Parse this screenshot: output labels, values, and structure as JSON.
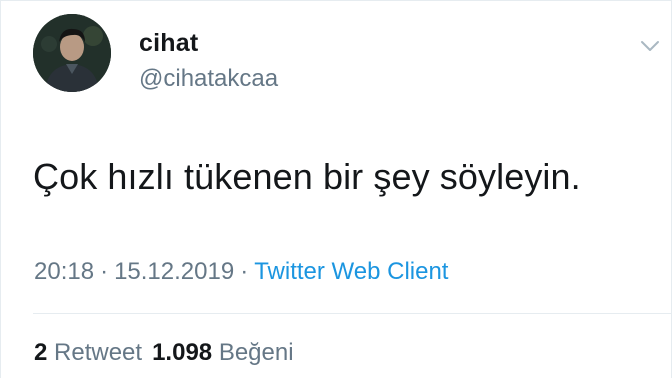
{
  "tweet": {
    "author": {
      "display_name": "cihat",
      "handle": "@cihatakcaa",
      "avatar_icon": "profile-photo"
    },
    "menu_icon": "chevron-down-icon",
    "text": "Çok hızlı tükenen bir şey söyleyin.",
    "meta": {
      "time": "20:18",
      "separator": "·",
      "date": "15.12.2019",
      "client": "Twitter Web Client"
    },
    "stats": {
      "retweets_count": "2",
      "retweets_label": "Retweet",
      "likes_count": "1.098",
      "likes_label": "Beğeni"
    }
  },
  "colors": {
    "text_primary": "#14171a",
    "text_secondary": "#657786",
    "link": "#1b95e0",
    "border": "#e6ecf0"
  }
}
